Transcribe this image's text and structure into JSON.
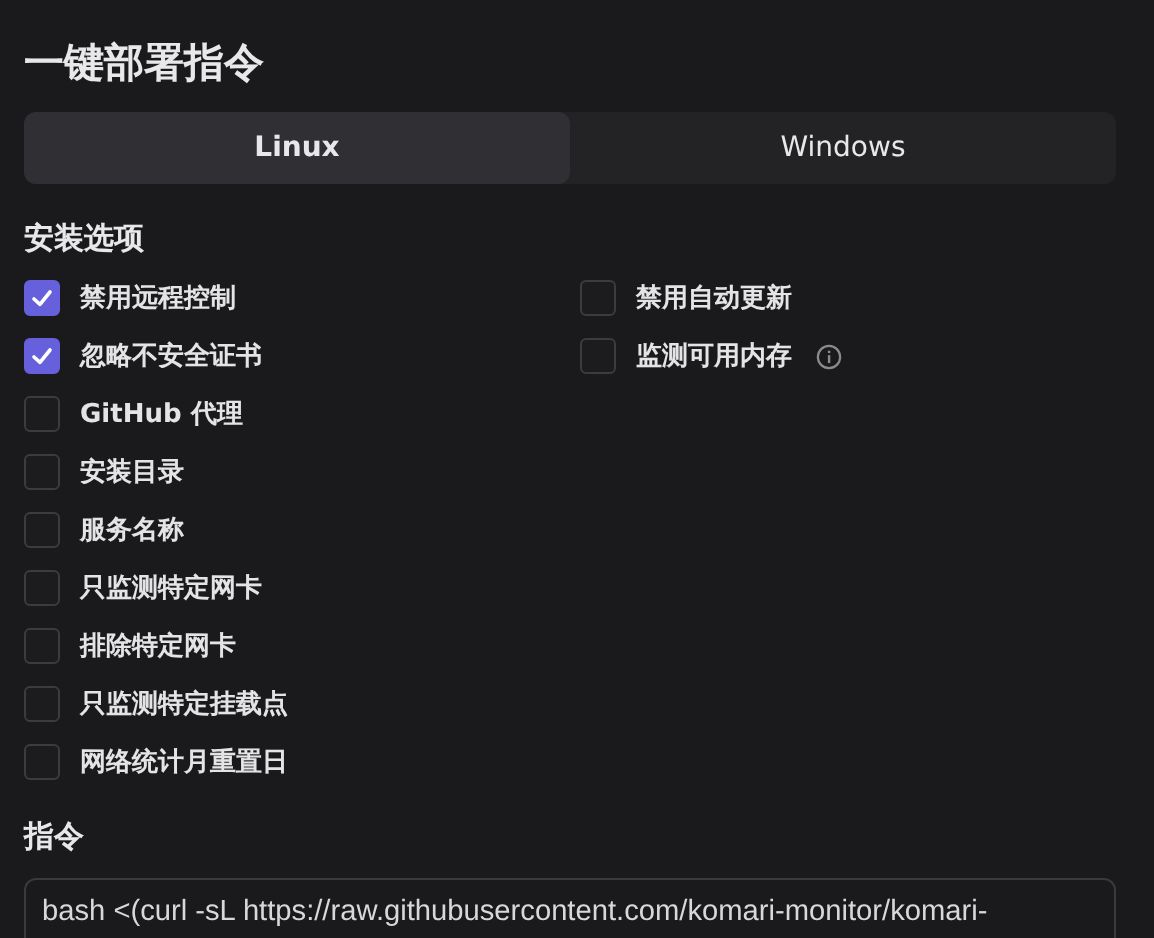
{
  "title": "一键部署指令",
  "tabs": [
    {
      "label": "Linux",
      "selected": true
    },
    {
      "label": "Windows",
      "selected": false
    }
  ],
  "install_options": {
    "heading": "安装选项",
    "columns": [
      [
        {
          "label": "禁用远程控制",
          "checked": true,
          "info_icon": false
        },
        {
          "label": "忽略不安全证书",
          "checked": true,
          "info_icon": false
        },
        {
          "label": "GitHub 代理",
          "checked": false,
          "info_icon": false
        },
        {
          "label": "安装目录",
          "checked": false,
          "info_icon": false
        },
        {
          "label": "服务名称",
          "checked": false,
          "info_icon": false
        },
        {
          "label": "只监测特定网卡",
          "checked": false,
          "info_icon": false
        },
        {
          "label": "排除特定网卡",
          "checked": false,
          "info_icon": false
        },
        {
          "label": "只监测特定挂载点",
          "checked": false,
          "info_icon": false
        },
        {
          "label": "网络统计月重置日",
          "checked": false,
          "info_icon": false
        }
      ],
      [
        {
          "label": "禁用自动更新",
          "checked": false,
          "info_icon": false
        },
        {
          "label": "监测可用内存",
          "checked": false,
          "info_icon": true
        }
      ]
    ]
  },
  "command": {
    "heading": "指令",
    "value": "bash <(curl -sL https://raw.githubusercontent.com/komari-monitor/komari-"
  }
}
